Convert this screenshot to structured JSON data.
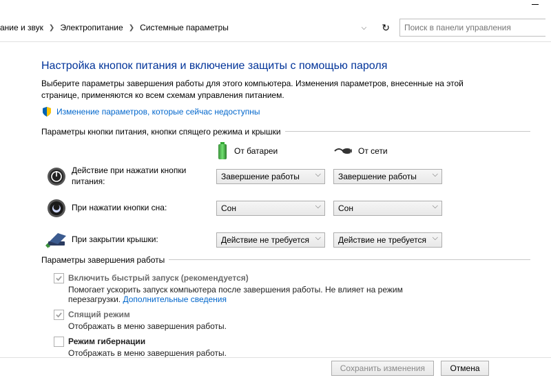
{
  "breadcrumbs": {
    "frag0": "ание и звук",
    "frag1": "Электропитание",
    "frag2": "Системные параметры"
  },
  "search": {
    "placeholder": "Поиск в панели управления"
  },
  "page": {
    "title": "Настройка кнопок питания и включение защиты с помощью пароля",
    "desc": "Выберите параметры завершения работы для этого компьютера. Изменения параметров, внесенные на этой странице, применяются ко всем схемам управления питанием.",
    "uac_link": "Изменение параметров, которые сейчас недоступны"
  },
  "group_buttons": {
    "legend": "Параметры кнопки питания, кнопки спящего режима и крышки",
    "col_battery": "От батареи",
    "col_ac": "От сети",
    "rows": {
      "power": {
        "label": "Действие при нажатии кнопки питания:",
        "battery": "Завершение работы",
        "ac": "Завершение работы"
      },
      "sleep": {
        "label": "При нажатии кнопки сна:",
        "battery": "Сон",
        "ac": "Сон"
      },
      "lid": {
        "label": "При закрытии крышки:",
        "battery": "Действие не требуется",
        "ac": "Действие не требуется"
      }
    }
  },
  "group_shutdown": {
    "legend": "Параметры завершения работы",
    "fast": {
      "label": "Включить быстрый запуск (рекомендуется)",
      "sub_pre": "Помогает ускорить запуск компьютера после завершения работы. Не влияет на режим перезагрузки. ",
      "sub_link": "Дополнительные сведения"
    },
    "sleep": {
      "label": "Спящий режим",
      "sub": "Отображать в меню завершения работы."
    },
    "hiber": {
      "label": "Режим гибернации",
      "sub": "Отображать в меню завершения работы."
    }
  },
  "buttons": {
    "save": "Сохранить изменения",
    "cancel": "Отмена"
  }
}
